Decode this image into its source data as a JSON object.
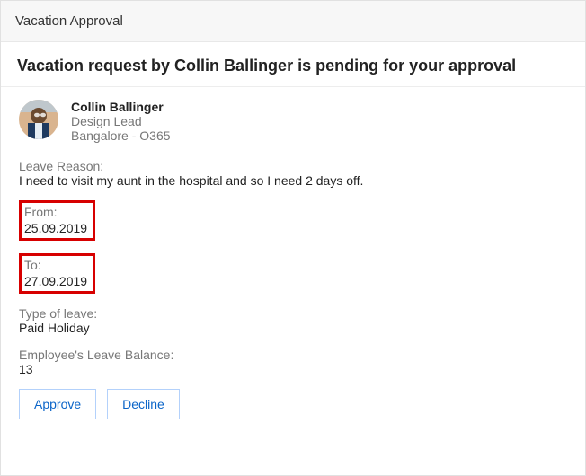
{
  "card": {
    "header": "Vacation Approval",
    "title": "Vacation request by Collin Ballinger is pending for your approval"
  },
  "requester": {
    "name": "Collin Ballinger",
    "role": "Design Lead",
    "location": "Bangalore - O365"
  },
  "reason": {
    "label": "Leave Reason:",
    "value": "I need to visit my aunt in the hospital and so I need 2 days off."
  },
  "from": {
    "label": "From:",
    "value": "25.09.2019"
  },
  "to": {
    "label": "To:",
    "value": "27.09.2019"
  },
  "leave_type": {
    "label": "Type of leave:",
    "value": "Paid Holiday"
  },
  "balance": {
    "label": "Employee's Leave Balance:",
    "value": "13"
  },
  "actions": {
    "approve": "Approve",
    "decline": "Decline"
  }
}
